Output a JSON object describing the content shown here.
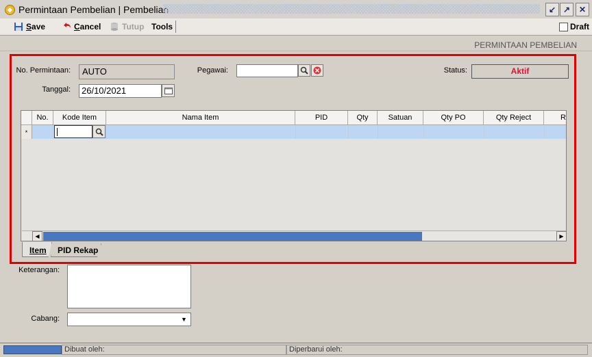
{
  "window": {
    "title": "Permintaan Pembelian | Pembelian"
  },
  "toolbar": {
    "save_label": "Save",
    "cancel_label": "Cancel",
    "tutup_label": "Tutup",
    "tools_label": "Tools",
    "draft_label": "Draft"
  },
  "form": {
    "heading": "PERMINTAAN PEMBELIAN",
    "no_permintaan_label": "No. Permintaan:",
    "no_permintaan_value": "AUTO",
    "tanggal_label": "Tanggal:",
    "tanggal_value": "26/10/2021",
    "pegawai_label": "Pegawai:",
    "pegawai_value": "",
    "status_label": "Status:",
    "status_value": "Aktif",
    "status_color": "#e0103a"
  },
  "grid": {
    "columns": [
      "No.",
      "Kode Item",
      "Nama Item",
      "PID",
      "Qty",
      "Satuan",
      "Qty PO",
      "Qty Reject",
      "Re"
    ],
    "new_row_marker": "*",
    "selected_row_color": "#bcd6f4"
  },
  "tabs": [
    {
      "label": "Item",
      "active": true
    },
    {
      "label": "PID Rekap",
      "active": false
    }
  ],
  "bottom": {
    "keterangan_label": "Keterangan:",
    "keterangan_value": "",
    "cabang_label": "Cabang:",
    "cabang_value": ""
  },
  "statusbar": {
    "dibuat_label": "Dibuat oleh:",
    "diperbarui_label": "Diperbarui oleh:"
  },
  "colors": {
    "highlight_border": "#e00000",
    "accent_blue": "#4a78c0"
  }
}
